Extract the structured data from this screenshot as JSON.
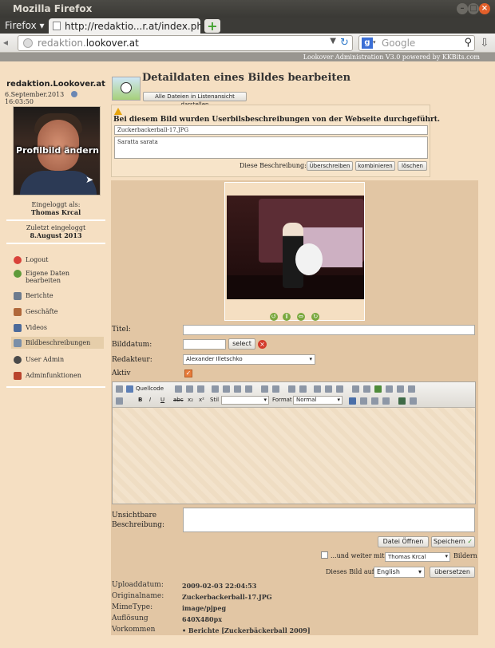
{
  "browser": {
    "window_title": "Mozilla Firefox",
    "menu_label": "Firefox",
    "tab_title": "http://redaktio...r.at/index.php",
    "new_tab": "+",
    "url_host": "redaktion.",
    "url_domain": "lookover.at",
    "search_placeholder": "Google",
    "search_engine_letter": "g"
  },
  "banner": "Lookover Administration V3.0 powered by KKBits.com",
  "sidebar": {
    "site_name": "redaktion.Lookover.at",
    "date": "6.September.2013",
    "time": "16:03:50",
    "profile_label": "Profilbild ändern",
    "logged_in_label": "Eingeloggt als:",
    "user_name": "Thomas Krcal",
    "last_login_label": "Zuletzt eingeloggt",
    "last_login_date": "8.August 2013",
    "items": [
      {
        "label": "Logout",
        "icon": "logout-icon",
        "color": "#d9423a"
      },
      {
        "label": "Eigene Daten bearbeiten",
        "icon": "user-icon",
        "color": "#5f9a3a"
      },
      {
        "label": "Berichte",
        "icon": "document-icon",
        "color": "#6d7b8e"
      },
      {
        "label": "Geschäfte",
        "icon": "shop-icon",
        "color": "#b0683b"
      },
      {
        "label": "Videos",
        "icon": "video-icon",
        "color": "#4c6a9a"
      },
      {
        "label": "Bildbeschreibungen",
        "icon": "image-icon",
        "color": "#7a8fa8"
      },
      {
        "label": "User Admin",
        "icon": "users-icon",
        "color": "#4a4a4a"
      },
      {
        "label": "Adminfunktionen",
        "icon": "tools-icon",
        "color": "#b9452e"
      }
    ]
  },
  "main": {
    "title": "Detaildaten eines Bildes bearbeiten",
    "list_view_button": "Alle Dateien in Listenansicht darstellen",
    "warning": "Bei diesem Bild wurden Userbilsbeschreibungen von der Webseite durchgeführt.",
    "user_filename": "Zuckerbackerball-17.JPG",
    "user_description": "Saratta sarata",
    "this_description_label": "Diese Beschreibung:",
    "overwrite_button": "Überschreiben",
    "combine_button": "kombinieren",
    "delete_button": "löschen"
  },
  "form": {
    "title_label": "Titel:",
    "title_value": "",
    "date_label": "Bilddatum:",
    "date_value": "",
    "select_button": "select",
    "editor_label": "Redakteur:",
    "editor_value": "Alexander Illetschko",
    "active_label": "Aktiv",
    "toolbar": {
      "source": "Quellcode",
      "style_label": "Stil",
      "format_label": "Format",
      "format_value": "Normal"
    },
    "invisible_desc_label": "Unsichtbare Beschreibung:",
    "open_file_button": "Datei Öffnen",
    "save_button": "Speichern",
    "continue_label": "...und weiter mit",
    "continue_user": "Thomas Krcal",
    "images_label": "Bildern",
    "this_image_label": "Dieses Bild auf",
    "language_value": "English",
    "translate_button": "übersetzen"
  },
  "meta": [
    {
      "label": "Uploaddatum:",
      "value": "2009-02-03 22:04:53"
    },
    {
      "label": "Originalname:",
      "value": "Zuckerbackerball-17.JPG"
    },
    {
      "label": "MimeType:",
      "value": "image/pjpeg"
    },
    {
      "label": "Auflösung",
      "value": "640X480px"
    },
    {
      "label": "Vorkommen",
      "value": "• Berichte [Zuckerbäckerball 2009]"
    }
  ]
}
